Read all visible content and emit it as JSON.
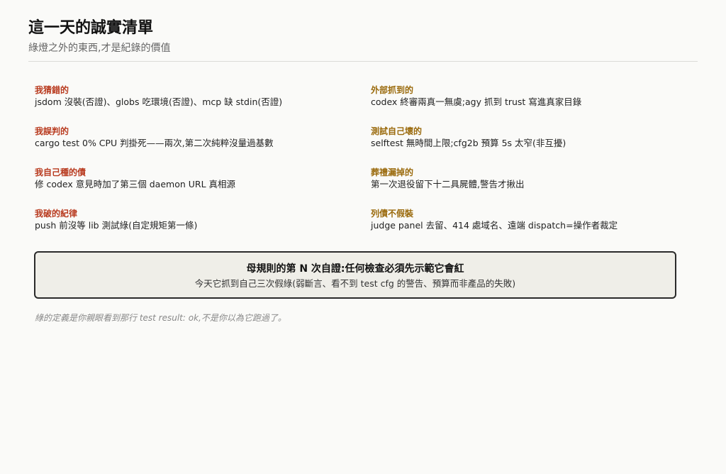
{
  "header": {
    "title": "這一天的誠實清單",
    "subtitle": "綠燈之外的東西,才是紀錄的價值"
  },
  "colors": {
    "left_label": "#b83a1e",
    "right_label": "#9a6a0c"
  },
  "items": [
    {
      "label": "我猜錯的",
      "text": "jsdom 沒裝(否證)、globs 吃環境(否證)、mcp 缺 stdin(否證)"
    },
    {
      "label": "外部抓到的",
      "text": "codex 終審兩真一無虞;agy 抓到 trust 寫進真家目錄"
    },
    {
      "label": "我誤判的",
      "text": "cargo test 0% CPU 判掛死——兩次,第二次純粹沒量過基數"
    },
    {
      "label": "測試自己壞的",
      "text": "selftest 無時間上限;cfg2b 預算 5s 太窄(非互擾)"
    },
    {
      "label": "我自己種的債",
      "text": "修 codex 意見時加了第三個 daemon URL 真相源"
    },
    {
      "label": "葬禮漏掉的",
      "text": "第一次退役留下十二具屍體,警告才揪出"
    },
    {
      "label": "我破的紀律",
      "text": "push 前沒等 lib 測試綠(自定規矩第一條)"
    },
    {
      "label": "列債不假裝",
      "text": "judge panel 去留、414 處域名、遠端 dispatch=操作者裁定"
    }
  ],
  "callout": {
    "title": "母規則的第 N 次自證:任何檢查必須先示範它會紅",
    "text": "今天它抓到自己三次假綠(弱斷言、看不到 test cfg 的警告、預算而非產品的失敗)"
  },
  "footer": "綠的定義是你親眼看到那行 test result: ok,不是你以為它跑過了。"
}
